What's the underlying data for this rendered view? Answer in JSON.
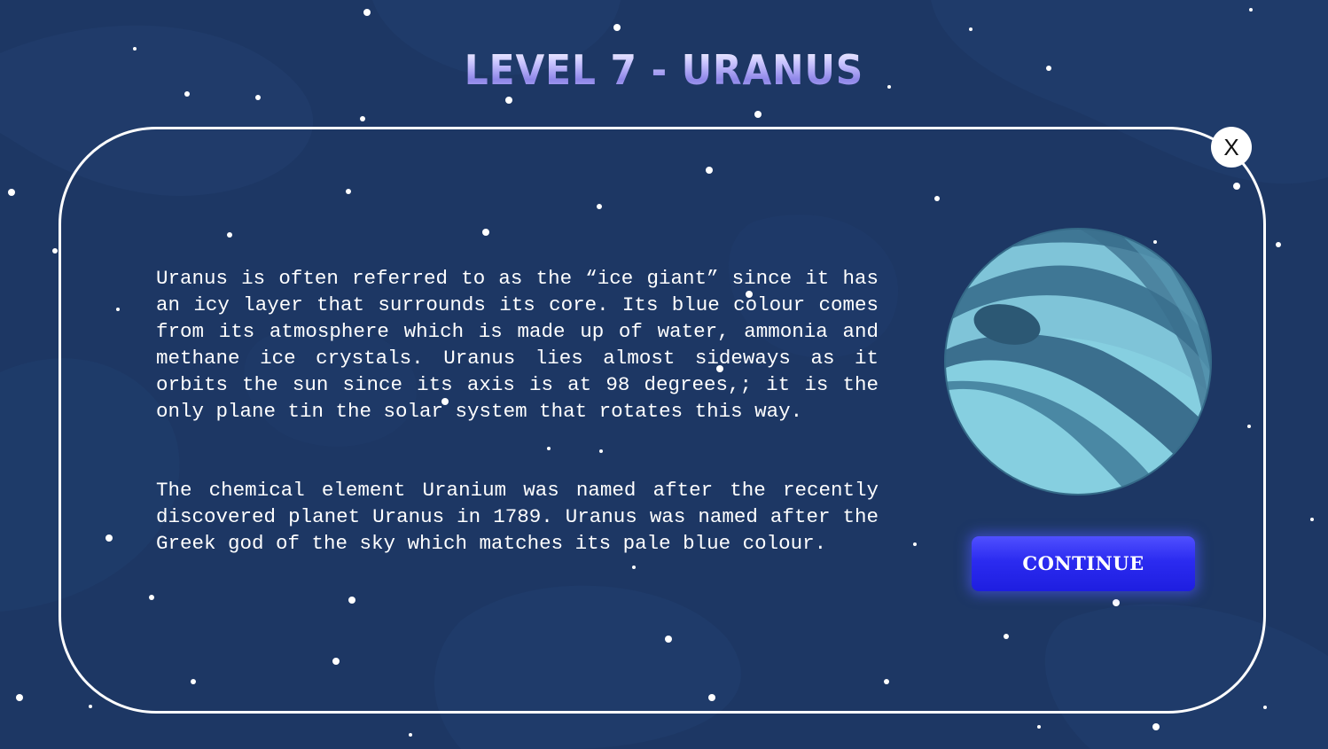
{
  "header": {
    "title": "LEVEL 7 - URANUS"
  },
  "dialog": {
    "close_label": "X",
    "paragraphs": [
      "Uranus is often referred to as the “ice giant” since it has an icy layer that surrounds its core. Its blue colour comes from its atmosphere which is made up of water, ammonia and methane ice crystals. Uranus lies almost sideways as it orbits the sun since its axis is at 98 degrees,; it is the only plane tin the solar system that rotates this way.",
      "The chemical element Uranium was named after the recently discovered planet Uranus in 1789. Uranus was named after the Greek god of the sky which matches its pale blue colour."
    ],
    "continue_label": "CONTINUE"
  },
  "colors": {
    "background": "#1d3764",
    "panel_border": "#ffffff",
    "button": "#2b2bf0",
    "planet_light": "#86cfe0",
    "planet_dark": "#3b6f8e"
  },
  "icons": {
    "close": "close-icon",
    "planet": "uranus-planet-icon"
  }
}
